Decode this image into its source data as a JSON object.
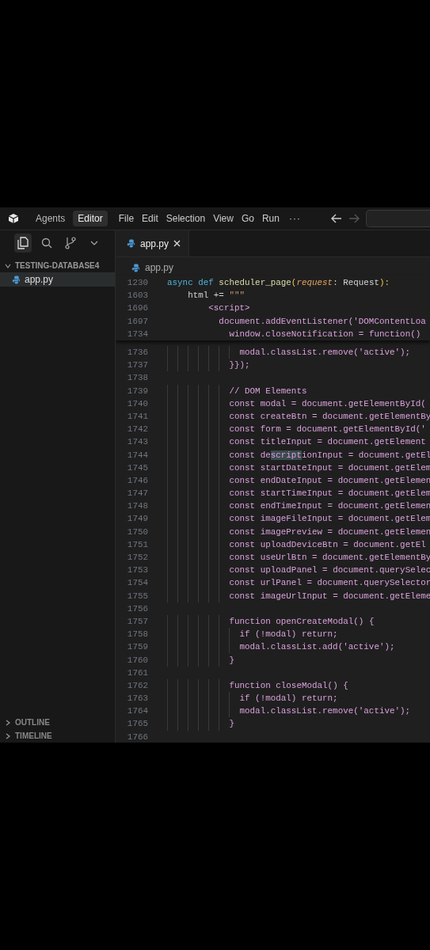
{
  "title_bar": {
    "mode_tabs": [
      {
        "label": "Agents",
        "selected": false
      },
      {
        "label": "Editor",
        "selected": true
      }
    ],
    "menu": [
      "File",
      "Edit",
      "Selection",
      "View",
      "Go",
      "Run"
    ],
    "more": "···",
    "nav": [
      {
        "kind": "back",
        "disabled": false
      },
      {
        "kind": "forward",
        "disabled": true
      }
    ]
  },
  "activity": [
    {
      "kind": "files",
      "selected": true
    },
    {
      "kind": "search",
      "selected": false
    },
    {
      "kind": "branch",
      "selected": false
    }
  ],
  "explorer": {
    "folder": "TESTING-DATABASE4",
    "expanded": true,
    "files": [
      {
        "name": "app.py",
        "selected": true
      }
    ]
  },
  "panels": [
    {
      "title": "OUTLINE",
      "expanded": false
    },
    {
      "title": "TIMELINE",
      "expanded": false
    }
  ],
  "editor": {
    "tabs": [
      {
        "label": "app.py",
        "selected": true
      }
    ],
    "breadcrumb": "app.py",
    "sticky": [
      {
        "number": "1230",
        "tokens": [
          {
            "text": "async def ",
            "kind": "keyword"
          },
          {
            "text": "scheduler_page",
            "kind": "function"
          },
          {
            "text": "(",
            "kind": "bracket"
          },
          {
            "text": "request",
            "kind": "param"
          },
          {
            "text": ": Request",
            "kind": "plain"
          },
          {
            "text": "):",
            "kind": "bracket"
          }
        ]
      },
      {
        "number": "1603",
        "tokens": [
          {
            "text": "    html += ",
            "kind": "plain"
          },
          {
            "text": "\"\"\"",
            "kind": "string"
          }
        ]
      },
      {
        "number": "1696",
        "tokens": [
          {
            "text": "        <script>",
            "kind": "embedded"
          }
        ]
      },
      {
        "number": "1697",
        "tokens": [
          {
            "text": "          document.addEventListener('DOMContentLoa",
            "kind": "embedded"
          }
        ]
      },
      {
        "number": "1734",
        "tokens": [
          {
            "text": "            window.closeNotification = function()",
            "kind": "embedded"
          }
        ]
      }
    ],
    "lines": [
      {
        "number": "1736",
        "tokens": [
          {
            "text": "              modal.classList.remove('active');",
            "kind": "embedded"
          }
        ]
      },
      {
        "number": "1737",
        "tokens": [
          {
            "text": "            }});",
            "kind": "embedded"
          }
        ]
      },
      {
        "number": "1738"
      },
      {
        "number": "1739",
        "tokens": [
          {
            "text": "            // DOM Elements",
            "kind": "embedded"
          }
        ]
      },
      {
        "number": "1740",
        "tokens": [
          {
            "text": "            const modal = document.getElementById(",
            "kind": "embedded"
          }
        ]
      },
      {
        "number": "1741",
        "tokens": [
          {
            "text": "            const createBtn = document.getElementBy",
            "kind": "embedded"
          }
        ]
      },
      {
        "number": "1742",
        "tokens": [
          {
            "text": "            const form = document.getElementById('",
            "kind": "embedded"
          }
        ]
      },
      {
        "number": "1743",
        "tokens": [
          {
            "text": "            const titleInput = document.getElement",
            "kind": "embedded"
          }
        ]
      },
      {
        "number": "1744",
        "tokens": [
          {
            "text": "            const de",
            "kind": "embedded"
          },
          {
            "text": "script",
            "kind": "match"
          },
          {
            "text": "ionInput = document.getEl",
            "kind": "embedded"
          }
        ]
      },
      {
        "number": "1745",
        "tokens": [
          {
            "text": "            const startDateInput = document.getElem",
            "kind": "embedded"
          }
        ]
      },
      {
        "number": "1746",
        "tokens": [
          {
            "text": "            const endDateInput = document.getElemen",
            "kind": "embedded"
          }
        ]
      },
      {
        "number": "1747",
        "tokens": [
          {
            "text": "            const startTimeInput = document.getElem",
            "kind": "embedded"
          }
        ]
      },
      {
        "number": "1748",
        "tokens": [
          {
            "text": "            const endTimeInput = document.getElemen",
            "kind": "embedded"
          }
        ]
      },
      {
        "number": "1749",
        "tokens": [
          {
            "text": "            const imageFileInput = document.getElem",
            "kind": "embedded"
          }
        ]
      },
      {
        "number": "1750",
        "tokens": [
          {
            "text": "            const imagePreview = document.getElemen",
            "kind": "embedded"
          }
        ]
      },
      {
        "number": "1751",
        "tokens": [
          {
            "text": "            const uploadDeviceBtn = document.getEl",
            "kind": "embedded"
          }
        ]
      },
      {
        "number": "1752",
        "tokens": [
          {
            "text": "            const useUrlBtn = document.getElementBy",
            "kind": "embedded"
          }
        ]
      },
      {
        "number": "1753",
        "tokens": [
          {
            "text": "            const uploadPanel = document.querySelec",
            "kind": "embedded"
          }
        ]
      },
      {
        "number": "1754",
        "tokens": [
          {
            "text": "            const urlPanel = document.querySelector",
            "kind": "embedded"
          }
        ]
      },
      {
        "number": "1755",
        "tokens": [
          {
            "text": "            const imageUrlInput = document.getEleme",
            "kind": "embedded"
          }
        ]
      },
      {
        "number": "1756"
      },
      {
        "number": "1757",
        "tokens": [
          {
            "text": "            function openCreateModal() {",
            "kind": "embedded"
          }
        ]
      },
      {
        "number": "1758",
        "tokens": [
          {
            "text": "              if (!modal) return;",
            "kind": "embedded"
          }
        ]
      },
      {
        "number": "1759",
        "tokens": [
          {
            "text": "              modal.classList.add('active');",
            "kind": "embedded"
          }
        ]
      },
      {
        "number": "1760",
        "tokens": [
          {
            "text": "            }",
            "kind": "embedded"
          }
        ]
      },
      {
        "number": "1761"
      },
      {
        "number": "1762",
        "tokens": [
          {
            "text": "            function closeModal() {",
            "kind": "embedded"
          }
        ]
      },
      {
        "number": "1763",
        "tokens": [
          {
            "text": "              if (!modal) return;",
            "kind": "embedded"
          }
        ]
      },
      {
        "number": "1764",
        "tokens": [
          {
            "text": "              modal.classList.remove('active');",
            "kind": "embedded"
          }
        ]
      },
      {
        "number": "1765",
        "tokens": [
          {
            "text": "            }",
            "kind": "embedded"
          }
        ]
      },
      {
        "number": "1766"
      }
    ]
  }
}
